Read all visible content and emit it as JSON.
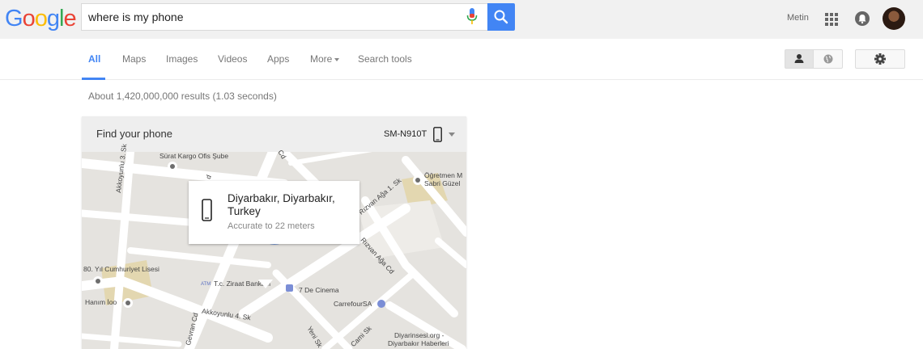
{
  "header": {
    "logo_letters": [
      {
        "char": "G",
        "color": "#4285f4"
      },
      {
        "char": "o",
        "color": "#ea4335"
      },
      {
        "char": "o",
        "color": "#fbbc05"
      },
      {
        "char": "g",
        "color": "#4285f4"
      },
      {
        "char": "l",
        "color": "#34a853"
      },
      {
        "char": "e",
        "color": "#ea4335"
      }
    ],
    "search_value": "where is my phone",
    "user_name": "Metin",
    "icons": [
      "mic-icon",
      "search-icon",
      "apps-grid-icon",
      "notifications-icon",
      "avatar"
    ]
  },
  "tabs": {
    "items": [
      {
        "label": "All",
        "active": true
      },
      {
        "label": "Maps"
      },
      {
        "label": "Images"
      },
      {
        "label": "Videos"
      },
      {
        "label": "Apps"
      },
      {
        "label": "More"
      },
      {
        "label": "Search tools"
      }
    ],
    "right_icons": [
      "person-icon",
      "globe-icon",
      "gear-icon"
    ]
  },
  "results": {
    "stats": "About 1,420,000,000 results (1.03 seconds)"
  },
  "card": {
    "title": "Find your phone",
    "device": "SM-N910T",
    "popup": {
      "location": "Diyarbakır, Diyarbakır, Turkey",
      "accuracy": "Accurate to 22 meters"
    },
    "map_labels": {
      "surat": "Sürat Kargo Ofis Şube",
      "akkoyunlu3": "Akkoyunlu 3. Sk",
      "cd_top": "Cd",
      "d_label": "d",
      "ogretmen": "Öğretmen M",
      "sabri": "Sabri Güzel",
      "rizvan1": "Rızvan Ağa 1. Sk",
      "rizvan2": "Rızvan Ağa Cd",
      "lisesi": "80. Yıl Cumhuriyet Lisesi",
      "atm": "ATM",
      "ziraat": "T.c. Ziraat Bankası",
      "cinema": "7 De Cinema",
      "carrefour": "CarrefourSA",
      "hanim": "Hanım İoo",
      "akkoyunlu4": "Akkoyunlu 4. Sk",
      "gevran": "Gevran Cd",
      "yeni": "Yeni Sk",
      "cami": "Cami Sk",
      "diyarinsesi1": "Diyarinsesi.org -",
      "diyarinsesi2": "Diyarbakır Haberleri"
    }
  },
  "colors": {
    "accent": "#4285f4",
    "map_bg": "#e5e3df",
    "road": "#ffffff",
    "block": "#f2f0ec",
    "park": "#e3d7b0",
    "accuracy": "#7b9edc"
  }
}
